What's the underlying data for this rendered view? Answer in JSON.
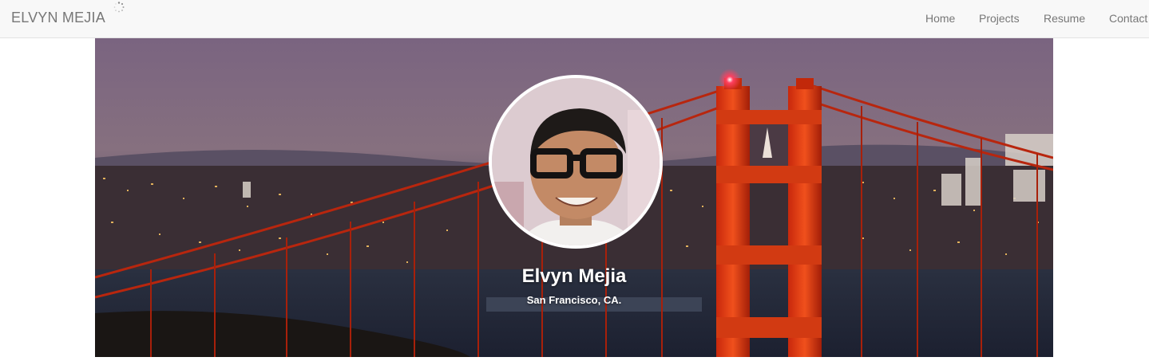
{
  "navbar": {
    "brand": "ELVYN MEJIA",
    "links": [
      {
        "label": "Home"
      },
      {
        "label": "Projects"
      },
      {
        "label": "Resume"
      },
      {
        "label": "Contact"
      }
    ]
  },
  "hero": {
    "name": "Elvyn Mejia",
    "location": "San Francisco, CA."
  },
  "icons": {
    "spinner": "loading-spinner-icon"
  }
}
